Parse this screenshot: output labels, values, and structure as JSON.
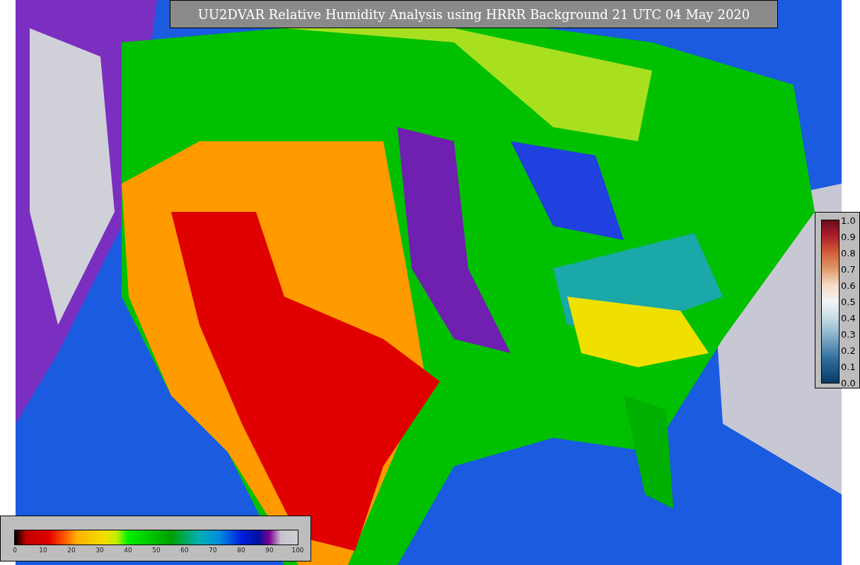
{
  "title": "UU2DVAR Relative Humidity Analysis using HRRR Background 21 UTC 04 May 2020",
  "humidity_colorbar": {
    "ticks": [
      "0",
      "10",
      "20",
      "30",
      "40",
      "50",
      "60",
      "70",
      "80",
      "90",
      "100"
    ]
  },
  "observation_colorbar": {
    "ticks": [
      "1.0",
      "0.9",
      "0.8",
      "0.7",
      "0.6",
      "0.5",
      "0.4",
      "0.3",
      "0.2",
      "0.1",
      "0.0"
    ]
  }
}
